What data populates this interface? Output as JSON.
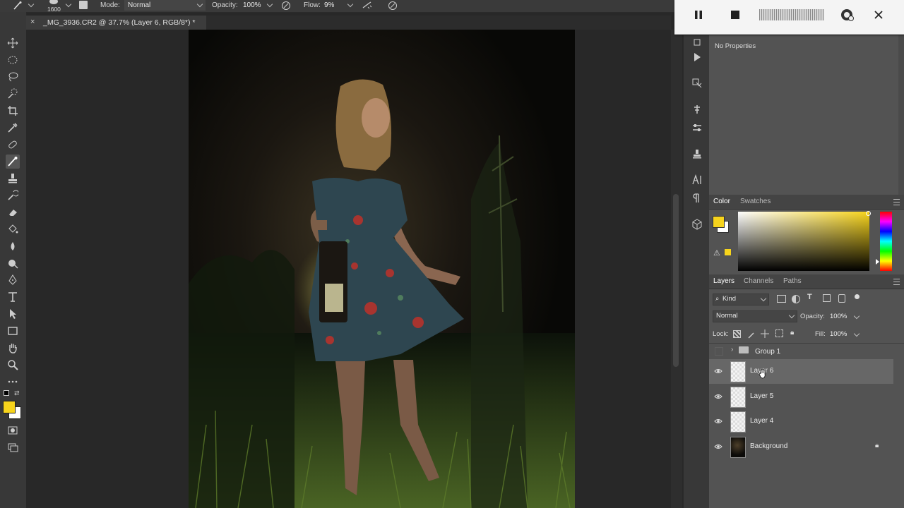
{
  "options_bar": {
    "brush_size": "1600",
    "mode_label": "Mode:",
    "mode_value": "Normal",
    "opacity_label": "Opacity:",
    "opacity_value": "100%",
    "flow_label": "Flow:",
    "flow_value": "9%"
  },
  "document": {
    "tab_title": "_MG_3936.CR2 @ 37.7% (Layer 6, RGB/8*) *",
    "close_glyph": "×"
  },
  "properties_panel": {
    "message": "No Properties"
  },
  "color_panel": {
    "tabs": [
      "Color",
      "Swatches"
    ],
    "foreground": "#f7d41c",
    "background": "#ffffff"
  },
  "layers_panel": {
    "tabs": [
      "Layers",
      "Channels",
      "Paths"
    ],
    "filter_label": "Kind",
    "blend_mode": "Normal",
    "opacity_label": "Opacity:",
    "opacity_value": "100%",
    "lock_label": "Lock:",
    "fill_label": "Fill:",
    "fill_value": "100%",
    "group_name": "Group 1",
    "layers": [
      {
        "name": "Layer 6",
        "selected": true
      },
      {
        "name": "Layer 5",
        "selected": false
      },
      {
        "name": "Layer 4",
        "selected": false
      },
      {
        "name": "Background",
        "selected": false,
        "locked": true
      }
    ]
  },
  "colors": {
    "accent_foreground": "#f7d41c",
    "selected_row": "#676767",
    "panel_bg": "#535353"
  }
}
